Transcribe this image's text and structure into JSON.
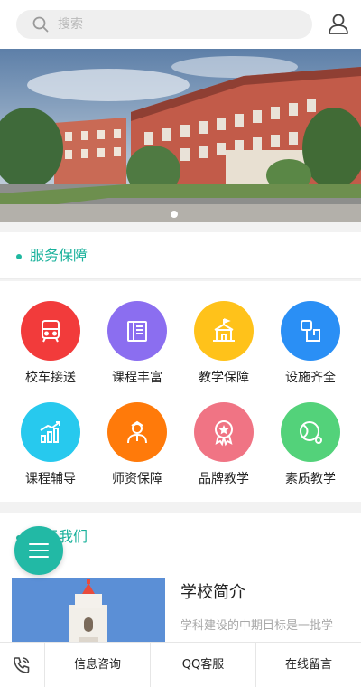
{
  "search": {
    "placeholder": "搜索"
  },
  "banner": {
    "slide_count": 1,
    "active_slide": 1
  },
  "sections": {
    "services_title": "服务保障",
    "about_title": "关于我们"
  },
  "services": [
    {
      "label": "校车接送",
      "icon": "bus-icon",
      "color": "#f23b3b"
    },
    {
      "label": "课程丰富",
      "icon": "book-icon",
      "color": "#8b6ef0"
    },
    {
      "label": "教学保障",
      "icon": "school-icon",
      "color": "#ffc21a"
    },
    {
      "label": "设施齐全",
      "icon": "facility-icon",
      "color": "#2a8ff5"
    },
    {
      "label": "课程辅导",
      "icon": "chart-icon",
      "color": "#27c9ee"
    },
    {
      "label": "师资保障",
      "icon": "teacher-icon",
      "color": "#ff7a0a"
    },
    {
      "label": "品牌教学",
      "icon": "award-icon",
      "color": "#f07484"
    },
    {
      "label": "素质教学",
      "icon": "tennis-icon",
      "color": "#53d27a"
    }
  ],
  "about": {
    "title": "学校简介",
    "desc": "学科建设的中期目标是一批学"
  },
  "bottom_bar": {
    "phone_icon": "phone-icon",
    "items": [
      "信息咨询",
      "QQ客服",
      "在线留言"
    ]
  }
}
